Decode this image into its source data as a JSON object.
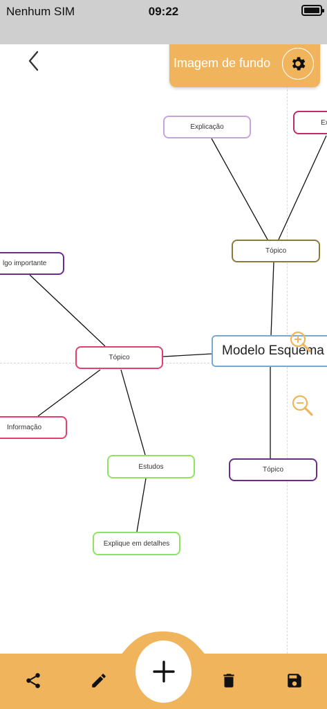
{
  "status_bar": {
    "carrier": "Nenhum SIM",
    "time": "09:22"
  },
  "header": {
    "background_button_label": "Imagem de fundo"
  },
  "map": {
    "center": "Modelo Esquema",
    "nodes": {
      "explicacao": "Explicação",
      "top_right": "Ex",
      "topico_upper": "Tópico",
      "algo_importante": "lgo importante",
      "topico_left": "Tópico",
      "informacao": "Informação",
      "estudos": "Estudos",
      "explique": "Explique em detalhes",
      "topico_lower": "Tópico"
    }
  },
  "colors": {
    "accent": "#f0b45d",
    "center_border": "#7ba7cf",
    "purple_light": "#c4a4db",
    "magenta": "#c2296b",
    "olive": "#8a7a3a",
    "purple_dark": "#6a2c8a",
    "pink": "#e33e6c",
    "green": "#8fe35e",
    "zoom": "#f0b45d"
  }
}
